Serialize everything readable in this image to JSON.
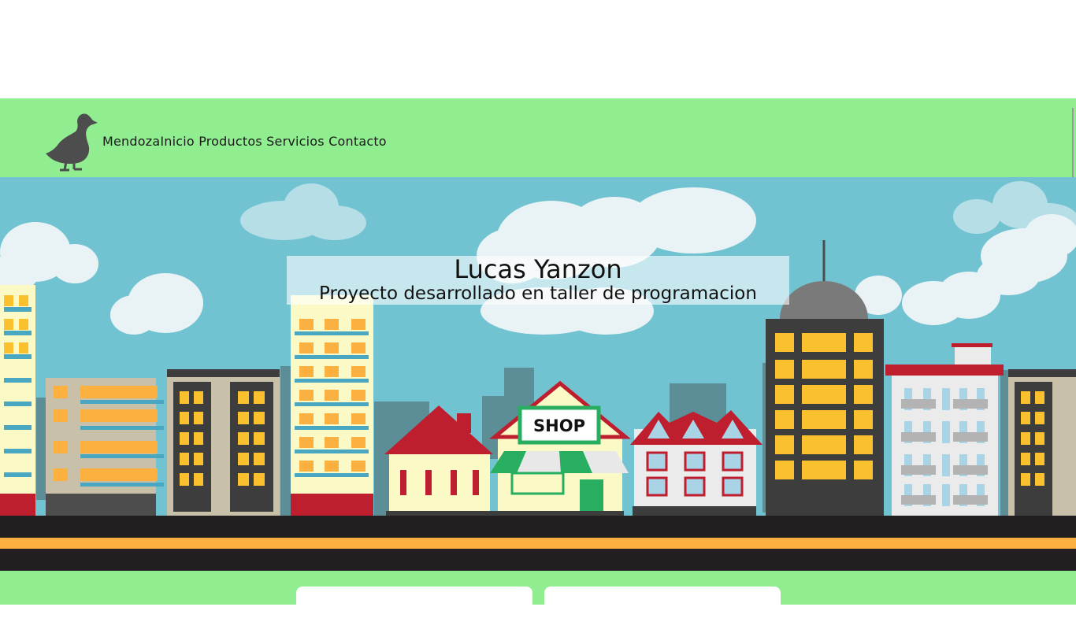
{
  "nav": {
    "brand": "Mendoza",
    "links": [
      "Inicio",
      "Productos",
      "Servicios",
      "Contacto"
    ]
  },
  "hero": {
    "title": "Lucas Yanzon",
    "subtitle": "Proyecto desarrollado en taller de programacion",
    "shop_sign": "SHOP"
  },
  "icons": {
    "logo": "duck-icon"
  },
  "colors": {
    "navbar": "#90ee90",
    "sky": "#72c3d2",
    "road": "#231f20",
    "road_stripe": "#fbb040"
  }
}
